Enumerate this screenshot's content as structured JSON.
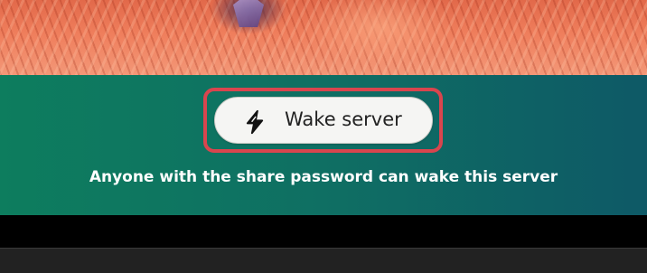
{
  "wake_button": {
    "label": "Wake server",
    "icon": "lightning-icon"
  },
  "hint_text": "Anyone with the share password can wake this server",
  "colors": {
    "highlight": "#d9454e",
    "banner_start": "#0d7d5e",
    "banner_end": "#0e5966",
    "button_bg": "#f5f5f3"
  }
}
